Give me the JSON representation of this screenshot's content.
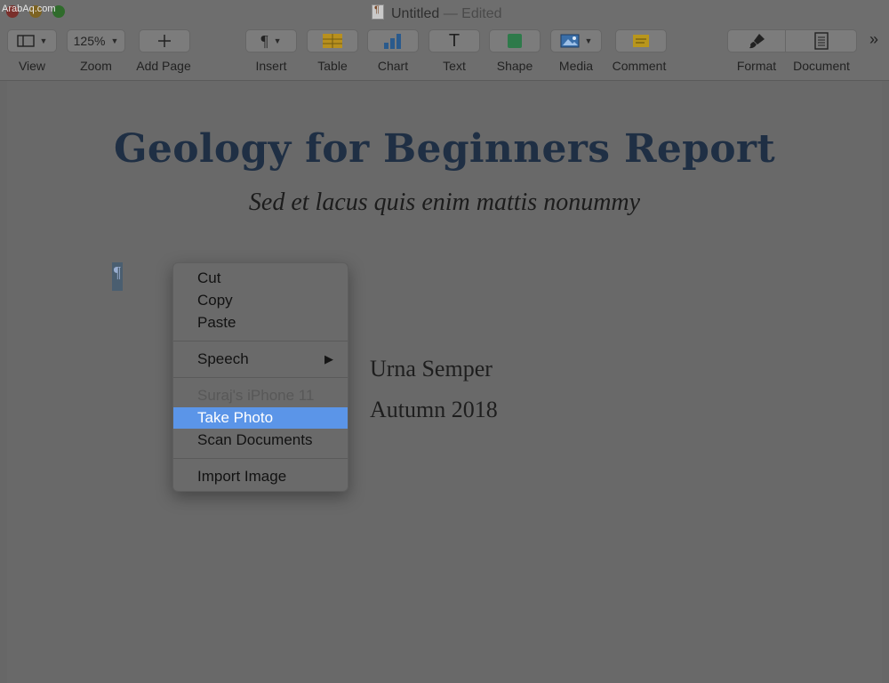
{
  "watermark": "ArabAq.com",
  "window": {
    "title": "Untitled",
    "edited": "— Edited"
  },
  "toolbar": {
    "view": {
      "label": "View",
      "icon": "sidebar-layout-icon"
    },
    "zoom": {
      "label": "Zoom",
      "value": "125%"
    },
    "add_page": {
      "label": "Add Page",
      "icon": "plus-icon"
    },
    "insert": {
      "label": "Insert",
      "icon": "pilcrow-icon"
    },
    "table": {
      "label": "Table",
      "icon": "table-icon"
    },
    "chart": {
      "label": "Chart",
      "icon": "bar-chart-icon"
    },
    "text": {
      "label": "Text",
      "icon": "text-T-icon"
    },
    "shape": {
      "label": "Shape",
      "icon": "square-icon"
    },
    "media": {
      "label": "Media",
      "icon": "image-icon"
    },
    "comment": {
      "label": "Comment",
      "icon": "comment-note-icon"
    },
    "format": {
      "label": "Format",
      "icon": "paintbrush-icon"
    },
    "document": {
      "label": "Document",
      "icon": "document-icon"
    },
    "overflow": "»"
  },
  "document": {
    "title": "Geology for Beginners Report",
    "subtitle": "Sed et lacus quis enim mattis nonummy",
    "pilcrow": "¶",
    "author": "Urna Semper",
    "term": "Autumn 2018"
  },
  "context_menu": {
    "cut": "Cut",
    "copy": "Copy",
    "paste": "Paste",
    "speech": "Speech",
    "device_header": "Suraj's iPhone 11",
    "take_photo": "Take Photo",
    "scan_documents": "Scan Documents",
    "import_image": "Import Image"
  },
  "colors": {
    "title_color": "#1f2f44",
    "selection_highlight": "#5b95e8"
  }
}
